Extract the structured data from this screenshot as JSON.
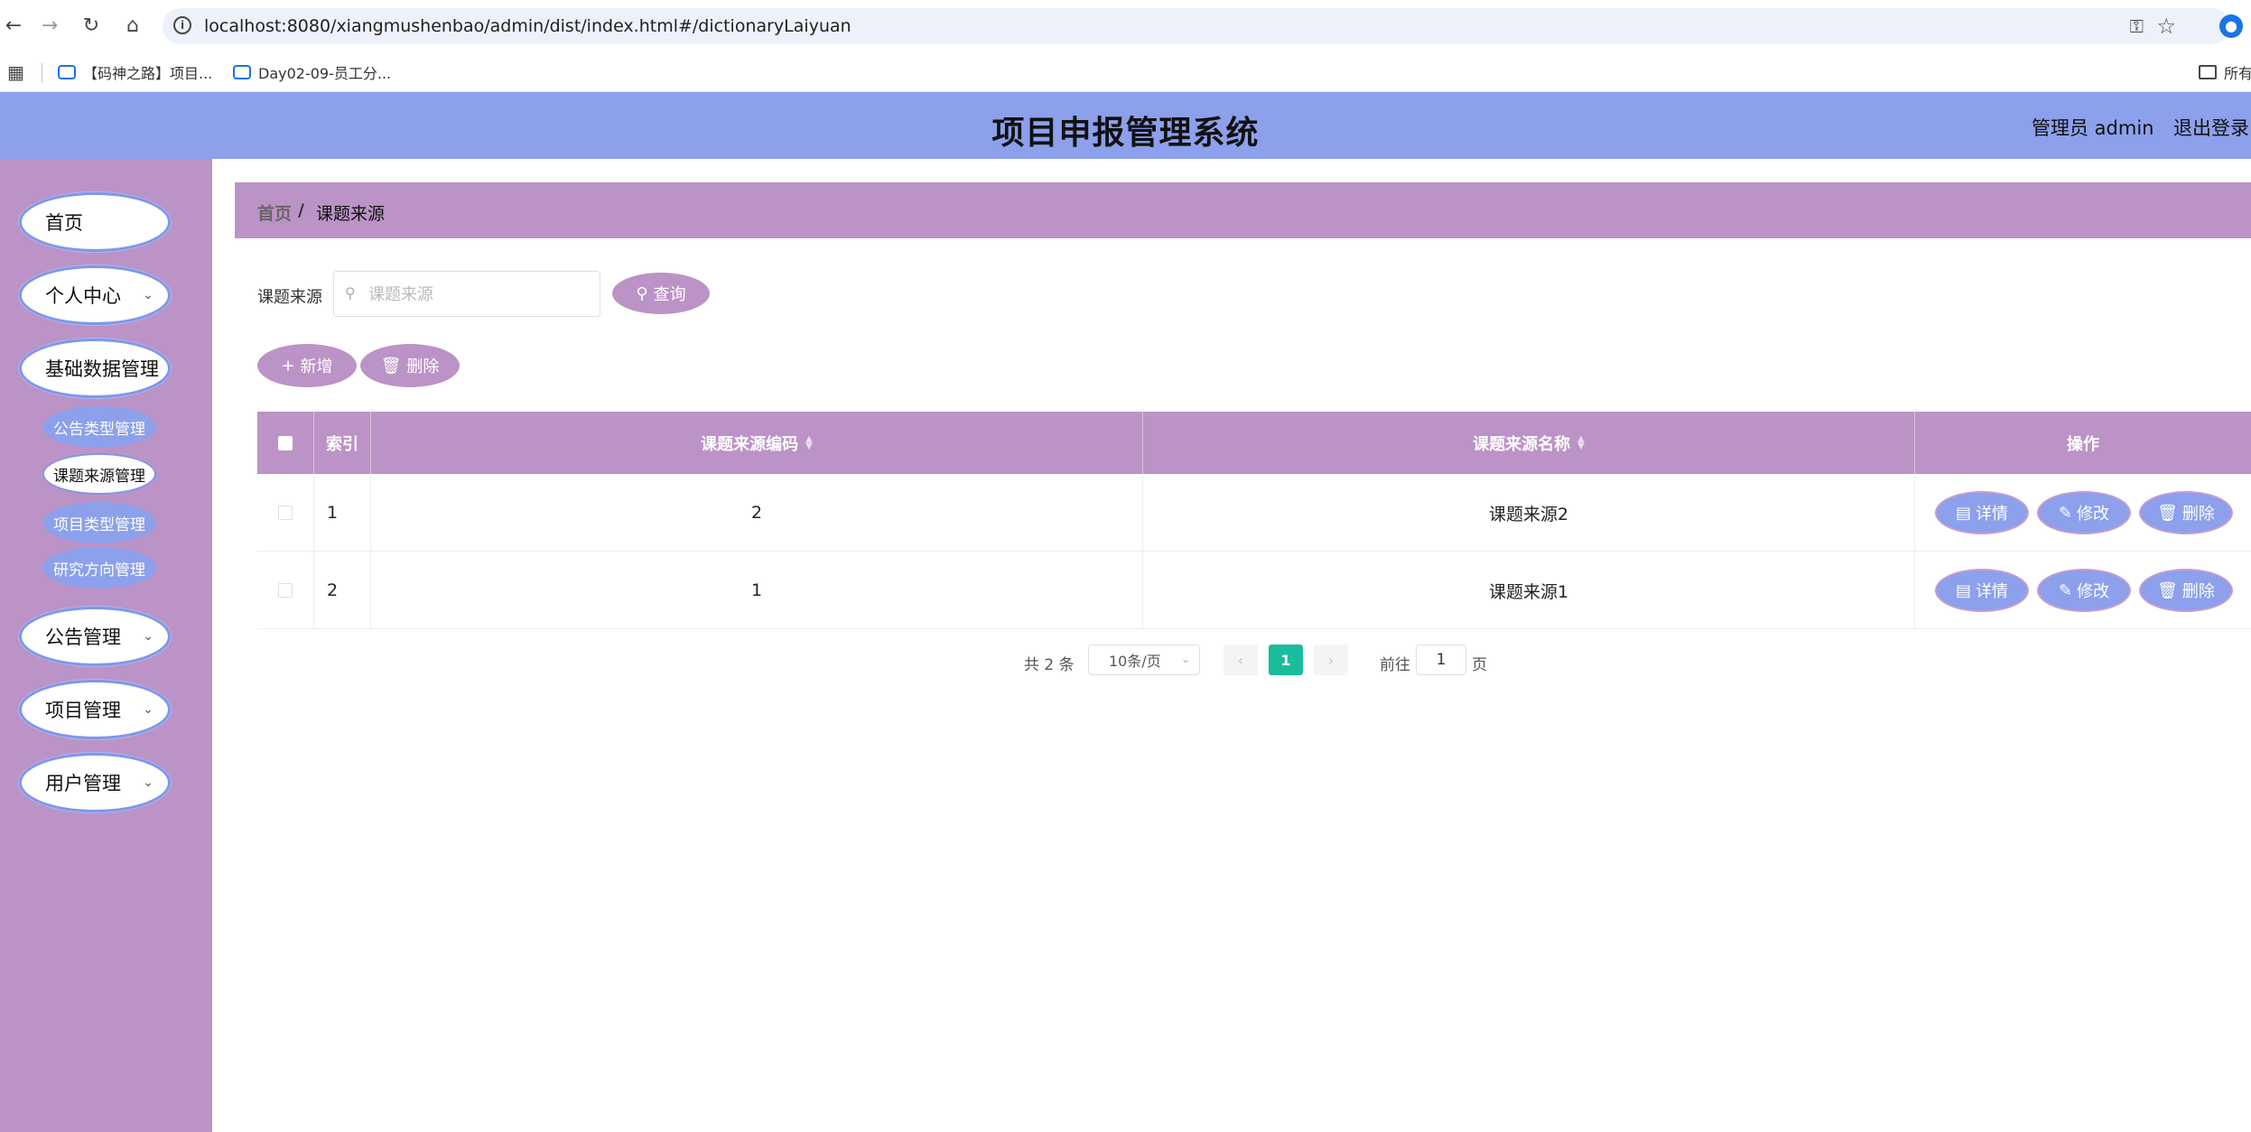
{
  "browser": {
    "url": "localhost:8080/xiangmushenbao/admin/dist/index.html#/dictionaryLaiyuan",
    "bookmarks": [
      "【码神之路】项目...",
      "Day02-09-员工分..."
    ],
    "bookmarks_folder": "所有"
  },
  "header": {
    "title": "项目申报管理系统",
    "user_label": "管理员 admin",
    "logout_label": "退出登录"
  },
  "sidebar": {
    "items": [
      {
        "label": "首页"
      },
      {
        "label": "个人中心"
      },
      {
        "label": "基础数据管理"
      },
      {
        "label": "公告管理"
      },
      {
        "label": "项目管理"
      },
      {
        "label": "用户管理"
      }
    ],
    "subitems": [
      {
        "label": "公告类型管理"
      },
      {
        "label": "课题来源管理"
      },
      {
        "label": "项目类型管理"
      },
      {
        "label": "研究方向管理"
      }
    ]
  },
  "breadcrumb": {
    "home": "首页",
    "separator": "/",
    "current": "课题来源"
  },
  "search": {
    "label": "课题来源",
    "placeholder": "课题来源",
    "query_label": "查询"
  },
  "actions": {
    "add_label": "新增",
    "delete_label": "删除"
  },
  "table": {
    "columns": [
      "索引",
      "课题来源编码",
      "课题来源名称",
      "操作"
    ],
    "rows": [
      {
        "index": "1",
        "code": "2",
        "name": "课题来源2"
      },
      {
        "index": "2",
        "code": "1",
        "name": "课题来源1"
      }
    ],
    "row_actions": {
      "detail": "详情",
      "edit": "修改",
      "delete": "删除"
    }
  },
  "pagination": {
    "total": "共 2 条",
    "page_size": "10条/页",
    "current_page": "1",
    "goto_prefix": "前往",
    "goto_value": "1",
    "goto_suffix": "页"
  },
  "colors": {
    "header_bg": "#8ca0ec",
    "sidebar_bg": "#bc93c6",
    "accent_purple": "#bc93c6",
    "accent_blue": "#8ca0ec",
    "page_active": "#1abc9c"
  }
}
